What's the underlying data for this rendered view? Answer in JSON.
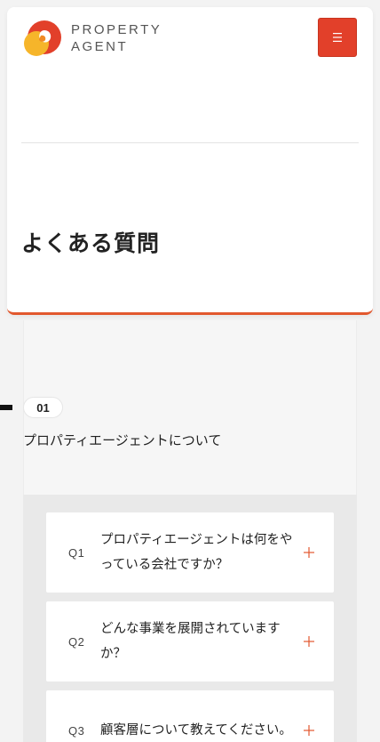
{
  "brand": {
    "line1": "PROPERTY",
    "line2": "AGENT",
    "logo_icon": "property-agent-logo",
    "colors": {
      "red": "#e2402a",
      "orange": "#f08a24",
      "yellow": "#f6b52a"
    }
  },
  "header": {
    "menu_icon": "hamburger-menu-icon",
    "menu_color": "#e2402a"
  },
  "page": {
    "title": "よくある質問"
  },
  "section": {
    "number": "01",
    "title": "プロパティエージェントについて"
  },
  "faq": {
    "expand_icon": "plus-icon",
    "accent": "#e2582e",
    "items": [
      {
        "num": "Q1",
        "question": "プロパティエージェントは何をやっている会社ですか？"
      },
      {
        "num": "Q2",
        "question": "どんな事業を展開されていますか？"
      },
      {
        "num": "Q3",
        "question": "顧客層について教えてください。"
      }
    ]
  }
}
